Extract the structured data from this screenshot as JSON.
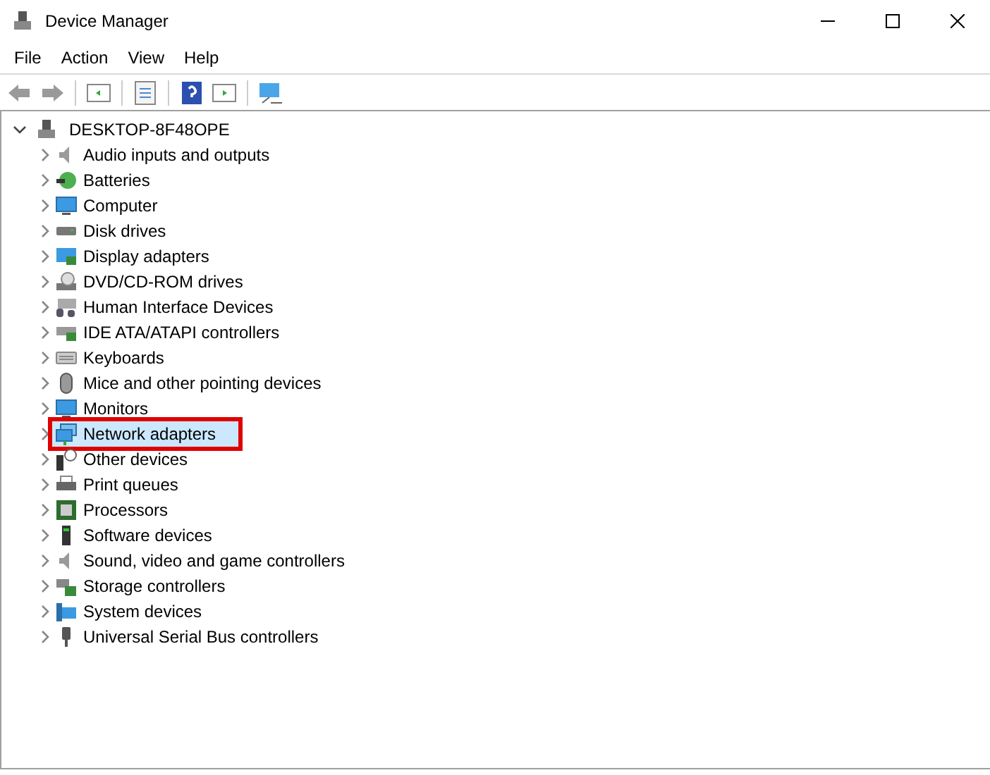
{
  "window": {
    "title": "Device Manager"
  },
  "menu": [
    "File",
    "Action",
    "View",
    "Help"
  ],
  "tree": {
    "label": "DESKTOP-8F48OPE",
    "expanded": true,
    "children": [
      {
        "label": "Audio inputs and outputs",
        "kind": "speaker",
        "expanded": false,
        "selected": false,
        "highlighted": false
      },
      {
        "label": "Batteries",
        "kind": "battery",
        "expanded": false,
        "selected": false,
        "highlighted": false
      },
      {
        "label": "Computer",
        "kind": "monitor",
        "expanded": false,
        "selected": false,
        "highlighted": false
      },
      {
        "label": "Disk drives",
        "kind": "disk",
        "expanded": false,
        "selected": false,
        "highlighted": false
      },
      {
        "label": "Display adapters",
        "kind": "display",
        "expanded": false,
        "selected": false,
        "highlighted": false
      },
      {
        "label": "DVD/CD-ROM drives",
        "kind": "dvd",
        "expanded": false,
        "selected": false,
        "highlighted": false
      },
      {
        "label": "Human Interface Devices",
        "kind": "hid",
        "expanded": false,
        "selected": false,
        "highlighted": false
      },
      {
        "label": "IDE ATA/ATAPI controllers",
        "kind": "card",
        "expanded": false,
        "selected": false,
        "highlighted": false
      },
      {
        "label": "Keyboards",
        "kind": "keyboard",
        "expanded": false,
        "selected": false,
        "highlighted": false
      },
      {
        "label": "Mice and other pointing devices",
        "kind": "mouse",
        "expanded": false,
        "selected": false,
        "highlighted": false
      },
      {
        "label": "Monitors",
        "kind": "monitor",
        "expanded": false,
        "selected": false,
        "highlighted": false
      },
      {
        "label": "Network adapters",
        "kind": "network",
        "expanded": false,
        "selected": true,
        "highlighted": true
      },
      {
        "label": "Other devices",
        "kind": "unknown",
        "expanded": false,
        "selected": false,
        "highlighted": false
      },
      {
        "label": "Print queues",
        "kind": "printer",
        "expanded": false,
        "selected": false,
        "highlighted": false
      },
      {
        "label": "Processors",
        "kind": "chip",
        "expanded": false,
        "selected": false,
        "highlighted": false
      },
      {
        "label": "Software devices",
        "kind": "tower",
        "expanded": false,
        "selected": false,
        "highlighted": false
      },
      {
        "label": "Sound, video and game controllers",
        "kind": "speaker",
        "expanded": false,
        "selected": false,
        "highlighted": false
      },
      {
        "label": "Storage controllers",
        "kind": "storage",
        "expanded": false,
        "selected": false,
        "highlighted": false
      },
      {
        "label": "System devices",
        "kind": "system",
        "expanded": false,
        "selected": false,
        "highlighted": false
      },
      {
        "label": "Universal Serial Bus controllers",
        "kind": "usb",
        "expanded": false,
        "selected": false,
        "highlighted": false
      }
    ]
  }
}
